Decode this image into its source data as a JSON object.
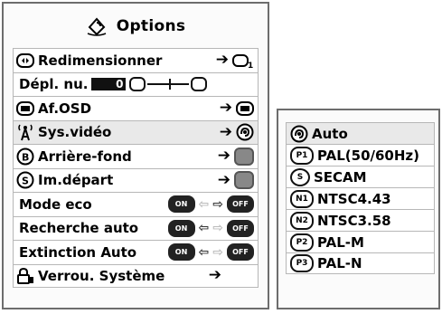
{
  "menu": {
    "title": "Options",
    "title_icon": "options-icon",
    "rows": [
      {
        "id": "redimensionner",
        "label": "Redimensionner",
        "icon": "resize-icon",
        "right_icon": "resize-mode-icon",
        "right_text": "1"
      },
      {
        "id": "depl-nu",
        "label": "Dépl. nu.",
        "value": "0"
      },
      {
        "id": "af-osd",
        "label": "Af.OSD",
        "icon": "osd-icon",
        "right_icon": "osd-icon"
      },
      {
        "id": "sys-video",
        "label": "Sys.vidéo",
        "icon": "antenna-icon",
        "right_icon": "auto-icon",
        "selected": true
      },
      {
        "id": "arriere-fond",
        "label": "Arrière-fond",
        "icon": "background-b-icon",
        "right_icon": "background-setting-icon"
      },
      {
        "id": "im-depart",
        "label": "Im.départ",
        "icon": "startup-s-icon",
        "right_icon": "startup-setting-icon"
      },
      {
        "id": "mode-eco",
        "label": "Mode eco",
        "left_pill": "ON",
        "right_pill": "OFF"
      },
      {
        "id": "recherche-auto",
        "label": "Recherche auto",
        "left_pill": "ON",
        "right_pill": "OFF"
      },
      {
        "id": "extinction-auto",
        "label": "Extinction Auto",
        "left_pill": "ON",
        "right_pill": "OFF"
      },
      {
        "id": "verrou-systeme",
        "label": "Verrou. Système",
        "icon": "lock-icon"
      }
    ]
  },
  "submenu": {
    "items": [
      {
        "badge": "auto",
        "label": "Auto",
        "selected": true
      },
      {
        "badge": "P1",
        "label": "PAL(50/60Hz)"
      },
      {
        "badge": "S",
        "label": "SECAM"
      },
      {
        "badge": "N1",
        "label": "NTSC4.43"
      },
      {
        "badge": "N2",
        "label": "NTSC3.58"
      },
      {
        "badge": "P2",
        "label": "PAL-M"
      },
      {
        "badge": "P3",
        "label": "PAL-N"
      }
    ]
  }
}
